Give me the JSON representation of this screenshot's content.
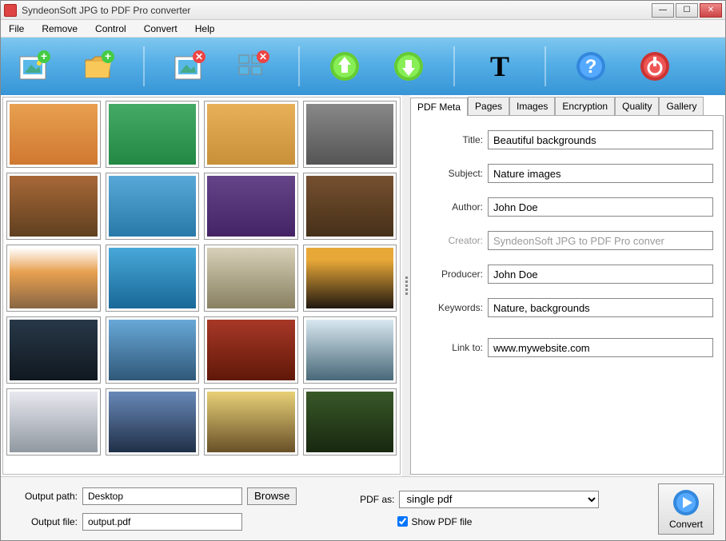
{
  "window": {
    "title": "SyndeonSoft JPG to PDF Pro converter"
  },
  "menu": {
    "items": [
      "File",
      "Remove",
      "Control",
      "Convert",
      "Help"
    ]
  },
  "toolbar": {
    "add_image": "Add image",
    "add_folder": "Add folder",
    "remove_image": "Remove image",
    "remove_all": "Remove all",
    "move_up": "Move up",
    "move_down": "Move down",
    "text": "Text",
    "help": "Help",
    "power": "Power"
  },
  "tabs": {
    "items": [
      "PDF Meta",
      "Pages",
      "Images",
      "Encryption",
      "Quality",
      "Gallery"
    ],
    "active": 0
  },
  "meta": {
    "labels": {
      "title": "Title:",
      "subject": "Subject:",
      "author": "Author:",
      "creator": "Creator:",
      "producer": "Producer:",
      "keywords": "Keywords:",
      "linkto": "Link to:"
    },
    "values": {
      "title": "Beautiful backgrounds",
      "subject": "Nature images",
      "author": "John Doe",
      "creator": "SyndeonSoft JPG to PDF Pro conver",
      "producer": "John Doe",
      "keywords": "Nature, backgrounds",
      "linkto": "www.mywebsite.com"
    }
  },
  "output": {
    "path_label": "Output path:",
    "path_value": "Desktop",
    "browse": "Browse",
    "file_label": "Output file:",
    "file_value": "output.pdf",
    "pdfas_label": "PDF as:",
    "pdfas_value": "single pdf",
    "showpdf_label": "Show PDF file",
    "showpdf_checked": true,
    "convert": "Convert"
  },
  "thumbs": [
    {
      "bg": "linear-gradient(#e8a050,#d07830)"
    },
    {
      "bg": "linear-gradient(#4a6,#284)"
    },
    {
      "bg": "linear-gradient(#e8b058,#c89038)"
    },
    {
      "bg": "linear-gradient(#888,#555)"
    },
    {
      "bg": "linear-gradient(#a86838,#604020)"
    },
    {
      "bg": "linear-gradient(#58a8d8,#2878a8)"
    },
    {
      "bg": "linear-gradient(#648,#426)"
    },
    {
      "bg": "linear-gradient(#765030,#453018)"
    },
    {
      "bg": "linear-gradient(#fff,#e8a050 40%,#864)"
    },
    {
      "bg": "linear-gradient(#48a8d8,#186898)"
    },
    {
      "bg": "linear-gradient(#d8d0b8,#888060)"
    },
    {
      "bg": "linear-gradient(#e8a838 20%,#201810)"
    },
    {
      "bg": "linear-gradient(#283848,#101820)"
    },
    {
      "bg": "linear-gradient(#68a8d8,#305878)"
    },
    {
      "bg": "linear-gradient(#a83828,#601808)"
    },
    {
      "bg": "linear-gradient(#d8e8f0,#486878)"
    },
    {
      "bg": "linear-gradient(#e8e8f0,#9098a0)"
    },
    {
      "bg": "linear-gradient(#6888b8,#203048)"
    },
    {
      "bg": "linear-gradient(#e8d078,#685028)"
    },
    {
      "bg": "linear-gradient(#385828,#182810)"
    }
  ]
}
